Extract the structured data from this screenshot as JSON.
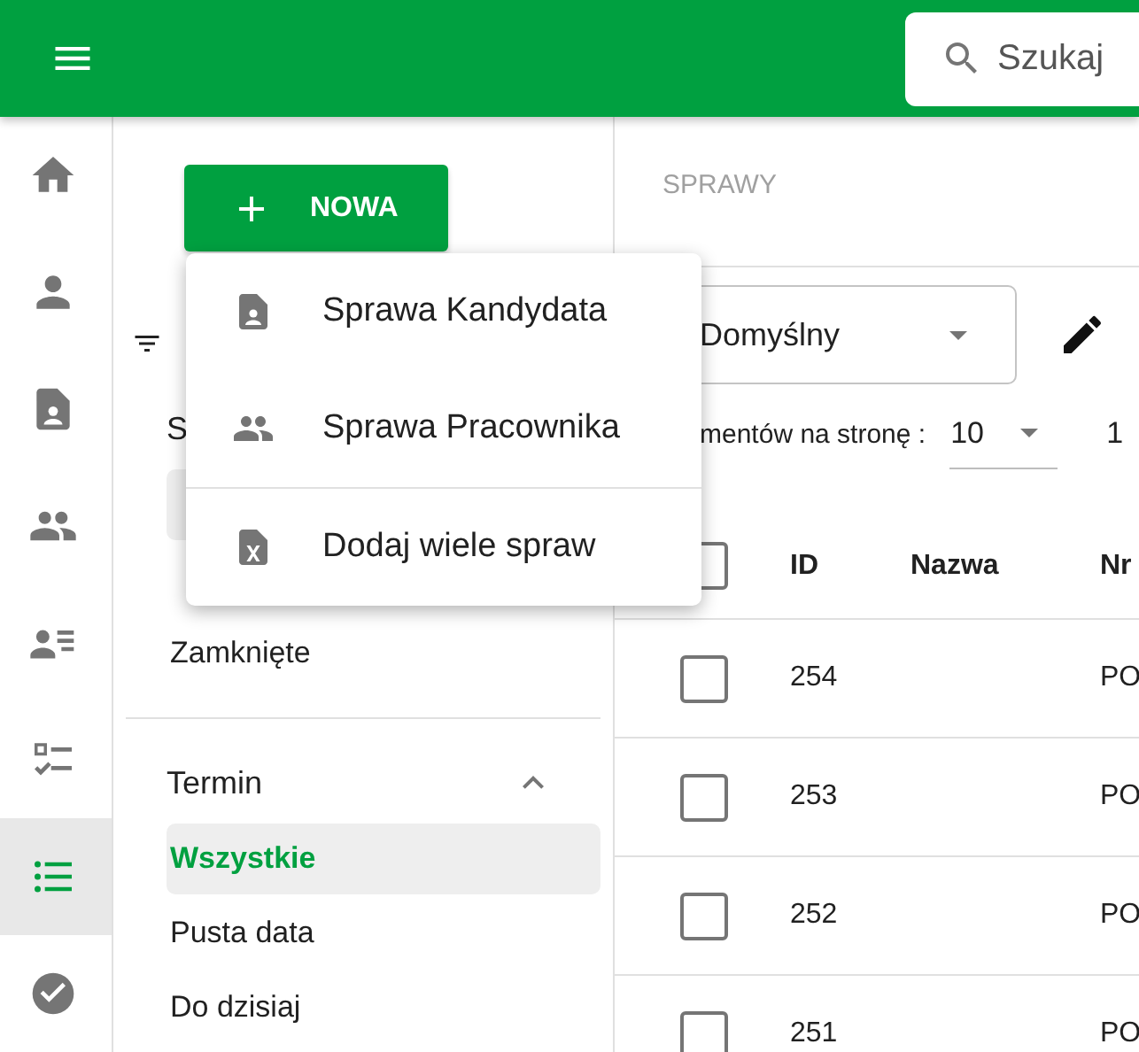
{
  "top_bar": {
    "search": {
      "placeholder": "Szukaj"
    }
  },
  "rail": [
    {
      "kind": "home",
      "selected": false
    },
    {
      "kind": "person",
      "selected": false
    },
    {
      "kind": "contact-doc",
      "selected": false
    },
    {
      "kind": "people",
      "selected": false
    },
    {
      "kind": "person-list",
      "selected": false
    },
    {
      "kind": "checklist",
      "selected": false
    },
    {
      "kind": "list",
      "selected": true
    },
    {
      "kind": "check-circle",
      "selected": false
    }
  ],
  "new_button": {
    "label": "NOWA"
  },
  "new_menu": {
    "items": [
      {
        "kind": "contact-doc",
        "label": "Sprawa Kandydata",
        "divider_before": false
      },
      {
        "kind": "people",
        "label": "Sprawa Pracownika",
        "divider_before": false
      },
      {
        "kind": "sheet-doc",
        "label": "Dodaj wiele spraw",
        "divider_before": true
      }
    ]
  },
  "filters": {
    "groups": [
      {
        "title": "S",
        "items": [
          {
            "selected": true
          },
          {
            "label": "Zamknięte",
            "selected": false
          }
        ]
      },
      {
        "title": "Termin",
        "expanded": true,
        "items": [
          {
            "label": "Wszystkie",
            "selected": true
          },
          {
            "label": "Pusta data",
            "selected": false
          },
          {
            "label": "Do dzisiaj",
            "selected": false
          }
        ]
      }
    ]
  },
  "main": {
    "breadcrumb": "SPRAWY",
    "view_select": {
      "value": "Domyślny"
    },
    "page_size": {
      "label": "mentów na stronę :",
      "value": "10"
    },
    "range": "1",
    "table": {
      "select_all": {
        "checked": false
      },
      "columns": [
        "ID",
        "Nazwa",
        "Nr"
      ],
      "rows": [
        {
          "checked": false,
          "id": "254",
          "nr": "PO"
        },
        {
          "checked": false,
          "id": "253",
          "nr": "PO"
        },
        {
          "checked": false,
          "id": "252",
          "nr": "PO"
        },
        {
          "checked": false,
          "id": "251",
          "nr": "PO"
        }
      ]
    }
  }
}
